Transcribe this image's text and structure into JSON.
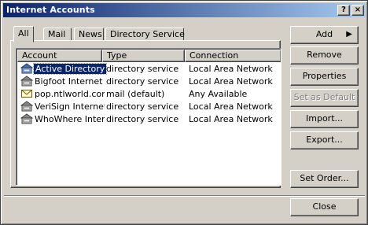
{
  "window": {
    "title": "Internet Accounts"
  },
  "titlebar_buttons": {
    "help": "?",
    "close": "×"
  },
  "tabs": [
    {
      "label": "All",
      "active": true
    },
    {
      "label": "Mail",
      "active": false
    },
    {
      "label": "News",
      "active": false
    },
    {
      "label": "Directory Service",
      "active": false
    }
  ],
  "list": {
    "columns": [
      "Account",
      "Type",
      "Connection"
    ],
    "rows": [
      {
        "icon": "directory-service-icon",
        "account": "Active Directory",
        "type": "directory service",
        "connection": "Local Area Network",
        "selected": true
      },
      {
        "icon": "directory-service-icon",
        "account": "Bigfoot Internet ...",
        "type": "directory service",
        "connection": "Local Area Network",
        "selected": false
      },
      {
        "icon": "mail-account-icon",
        "account": "pop.ntlworld.com",
        "type": "mail (default)",
        "connection": "Any Available",
        "selected": false
      },
      {
        "icon": "directory-service-icon",
        "account": "VeriSign Internet ...",
        "type": "directory service",
        "connection": "Local Area Network",
        "selected": false
      },
      {
        "icon": "directory-service-icon",
        "account": "WhoWhere Inter...",
        "type": "directory service",
        "connection": "Local Area Network",
        "selected": false
      }
    ]
  },
  "buttons": {
    "add": "Add",
    "remove": "Remove",
    "properties": "Properties",
    "set_default": "Set as Default",
    "import": "Import...",
    "export": "Export...",
    "set_order": "Set Order...",
    "close": "Close"
  },
  "colors": {
    "titlebar_start": "#0a246a",
    "titlebar_end": "#a6caf0",
    "face": "#d4d0c8",
    "selection": "#0a246a"
  }
}
